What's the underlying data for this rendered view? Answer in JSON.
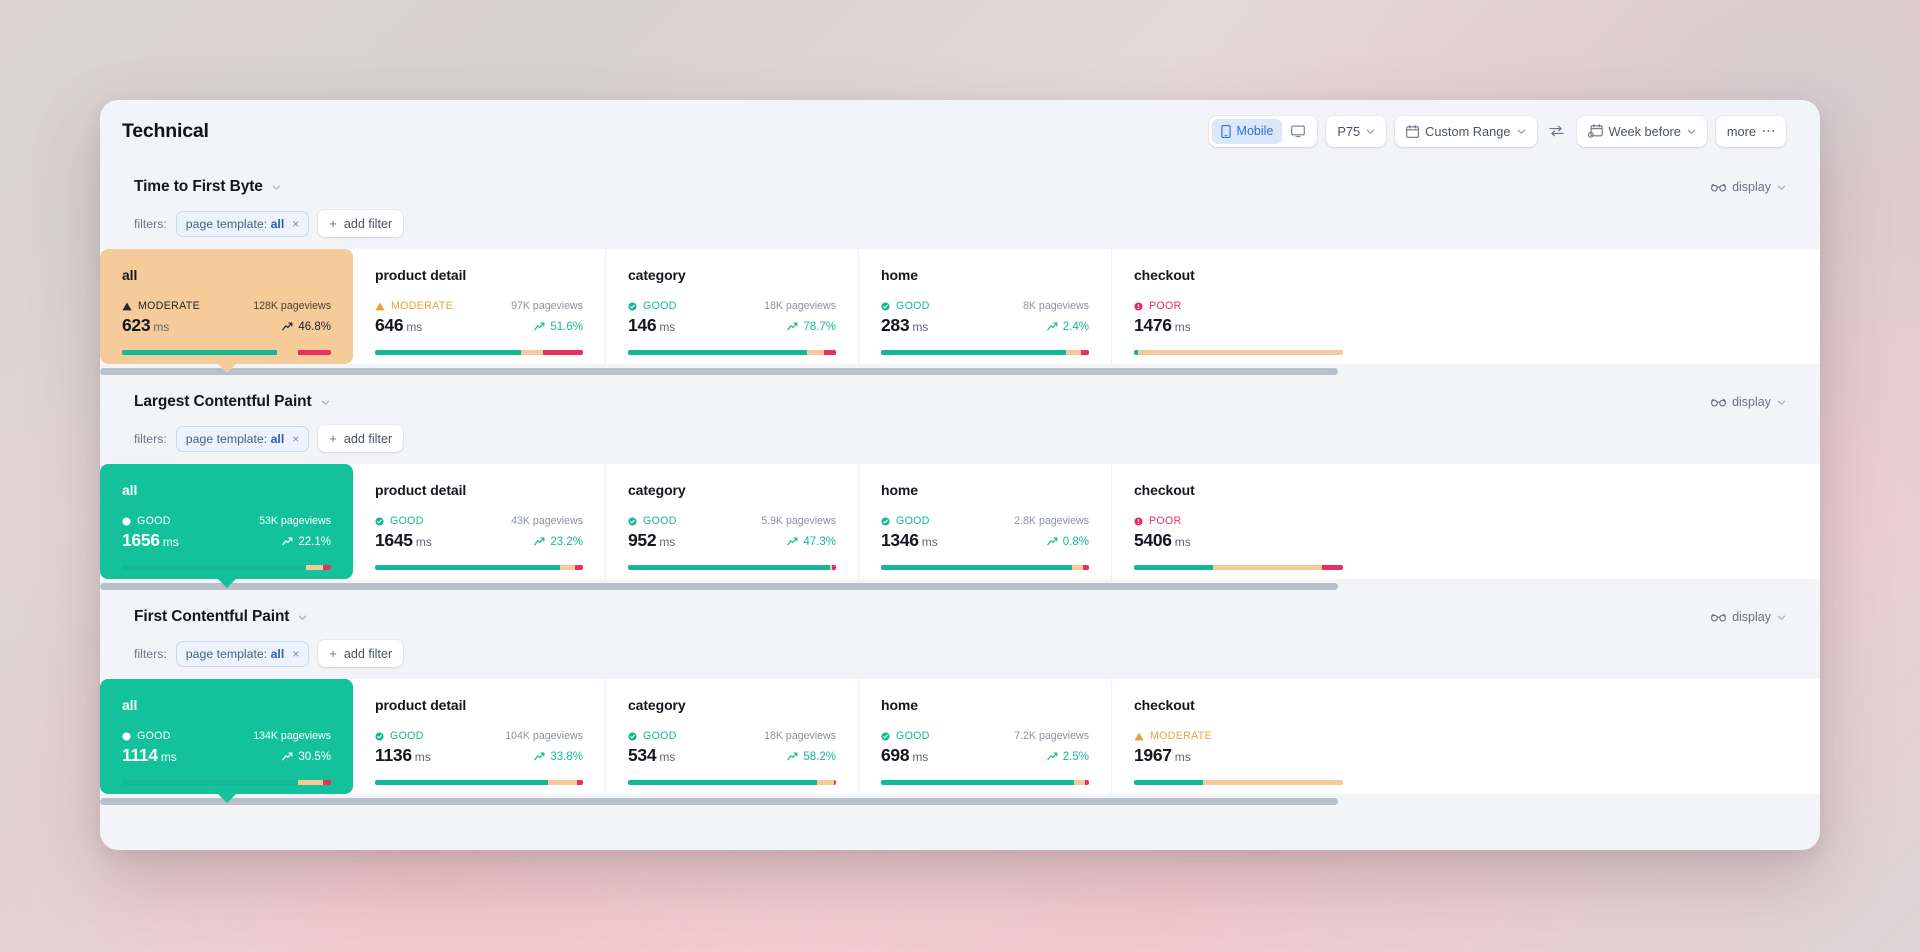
{
  "header": {
    "title": "Technical",
    "toolbar": {
      "device_group": {
        "mobile_label": "Mobile",
        "mobile_icon": "mobile-phone-icon",
        "desktop_icon": "desktop-monitor-icon",
        "selected": "Mobile"
      },
      "percentile": {
        "label": "P75",
        "icon": "chevron-down-icon"
      },
      "date_range": {
        "label": "Custom Range",
        "icon": "calendar-icon"
      },
      "swap_icon": "compare-swap-icon",
      "compare": {
        "label": "Week before",
        "icon": "calendar-compare-icon"
      },
      "more": {
        "label": "more",
        "icon": "ellipsis-icon"
      }
    }
  },
  "common": {
    "filters_label": "filters:",
    "filter_chip": {
      "prefix": "page template:",
      "value": "all",
      "remove": "×"
    },
    "add_filter_label": "add filter",
    "add_filter_plus": "+",
    "display_label": "display",
    "display_icon": "glasses-icon",
    "unit": "ms",
    "pageviews_suffix": "pageviews",
    "trend_icon": "trend-up-arrow-icon"
  },
  "sections": [
    {
      "id": "ttfb",
      "title": "Time to First Byte",
      "scroll_thumb_pct": 72,
      "cards": [
        {
          "name": "all",
          "rating": "MODERATE",
          "rating_kind": "moderate",
          "value": "623",
          "unit": "ms",
          "pageviews": "128K pageviews",
          "delta": "46.8%",
          "selected": true,
          "bars": [
            74,
            10,
            16
          ]
        },
        {
          "name": "product detail",
          "rating": "MODERATE",
          "rating_kind": "moderate",
          "value": "646",
          "unit": "ms",
          "pageviews": "97K pageviews",
          "delta": "51.6%",
          "selected": false,
          "bars": [
            70,
            11,
            19
          ]
        },
        {
          "name": "category",
          "rating": "GOOD",
          "rating_kind": "good",
          "value": "146",
          "unit": "ms",
          "pageviews": "18K pageviews",
          "delta": "78.7%",
          "selected": false,
          "bars": [
            86,
            8,
            6
          ]
        },
        {
          "name": "home",
          "rating": "GOOD",
          "rating_kind": "good",
          "value": "283",
          "unit": "ms",
          "pageviews": "8K pageviews",
          "delta": "2.4%",
          "selected": false,
          "bars": [
            89,
            7,
            4
          ]
        },
        {
          "name": "checkout",
          "rating": "POOR",
          "rating_kind": "poor",
          "value": "1476",
          "unit": "ms",
          "pageviews": "",
          "delta": "",
          "selected": false,
          "bars": [
            2,
            98,
            0
          ]
        }
      ]
    },
    {
      "id": "lcp",
      "title": "Largest Contentful Paint",
      "scroll_thumb_pct": 72,
      "cards": [
        {
          "name": "all",
          "rating": "GOOD",
          "rating_kind": "good",
          "value": "1656",
          "unit": "ms",
          "pageviews": "53K pageviews",
          "delta": "22.1%",
          "selected": true,
          "bars": [
            88,
            8,
            4
          ]
        },
        {
          "name": "product detail",
          "rating": "GOOD",
          "rating_kind": "good",
          "value": "1645",
          "unit": "ms",
          "pageviews": "43K pageviews",
          "delta": "23.2%",
          "selected": false,
          "bars": [
            89,
            7,
            4
          ]
        },
        {
          "name": "category",
          "rating": "GOOD",
          "rating_kind": "good",
          "value": "952",
          "unit": "ms",
          "pageviews": "5.9K pageviews",
          "delta": "47.3%",
          "selected": false,
          "bars": [
            97,
            1,
            2
          ]
        },
        {
          "name": "home",
          "rating": "GOOD",
          "rating_kind": "good",
          "value": "1346",
          "unit": "ms",
          "pageviews": "2.8K pageviews",
          "delta": "0.8%",
          "selected": false,
          "bars": [
            92,
            5,
            3
          ]
        },
        {
          "name": "checkout",
          "rating": "POOR",
          "rating_kind": "poor",
          "value": "5406",
          "unit": "ms",
          "pageviews": "",
          "delta": "",
          "selected": false,
          "bars": [
            38,
            52,
            10
          ]
        }
      ]
    },
    {
      "id": "fcp",
      "title": "First Contentful Paint",
      "scroll_thumb_pct": 72,
      "cards": [
        {
          "name": "all",
          "rating": "GOOD",
          "rating_kind": "good",
          "value": "1114",
          "unit": "ms",
          "pageviews": "134K pageviews",
          "delta": "30.5%",
          "selected": true,
          "bars": [
            84,
            12,
            4
          ]
        },
        {
          "name": "product detail",
          "rating": "GOOD",
          "rating_kind": "good",
          "value": "1136",
          "unit": "ms",
          "pageviews": "104K pageviews",
          "delta": "33.8%",
          "selected": false,
          "bars": [
            83,
            14,
            3
          ]
        },
        {
          "name": "category",
          "rating": "GOOD",
          "rating_kind": "good",
          "value": "534",
          "unit": "ms",
          "pageviews": "18K pageviews",
          "delta": "58.2%",
          "selected": false,
          "bars": [
            91,
            8,
            1
          ]
        },
        {
          "name": "home",
          "rating": "GOOD",
          "rating_kind": "good",
          "value": "698",
          "unit": "ms",
          "pageviews": "7.2K pageviews",
          "delta": "2.5%",
          "selected": false,
          "bars": [
            93,
            5,
            2
          ]
        },
        {
          "name": "checkout",
          "rating": "MODERATE",
          "rating_kind": "moderate",
          "value": "1967",
          "unit": "ms",
          "pageviews": "",
          "delta": "",
          "selected": false,
          "bars": [
            33,
            67,
            0
          ]
        }
      ]
    }
  ],
  "colors": {
    "good": "#13b894",
    "moderate": "#e9a13b",
    "poor": "#ea2e62",
    "bar_good": "#13b894",
    "bar_moderate": "#f6cb9a",
    "bar_poor": "#e8305f",
    "accent_blue": "#2f6ddb",
    "selected_good_bg": "#13c29b",
    "selected_moderate_bg": "#f6cb9a"
  }
}
